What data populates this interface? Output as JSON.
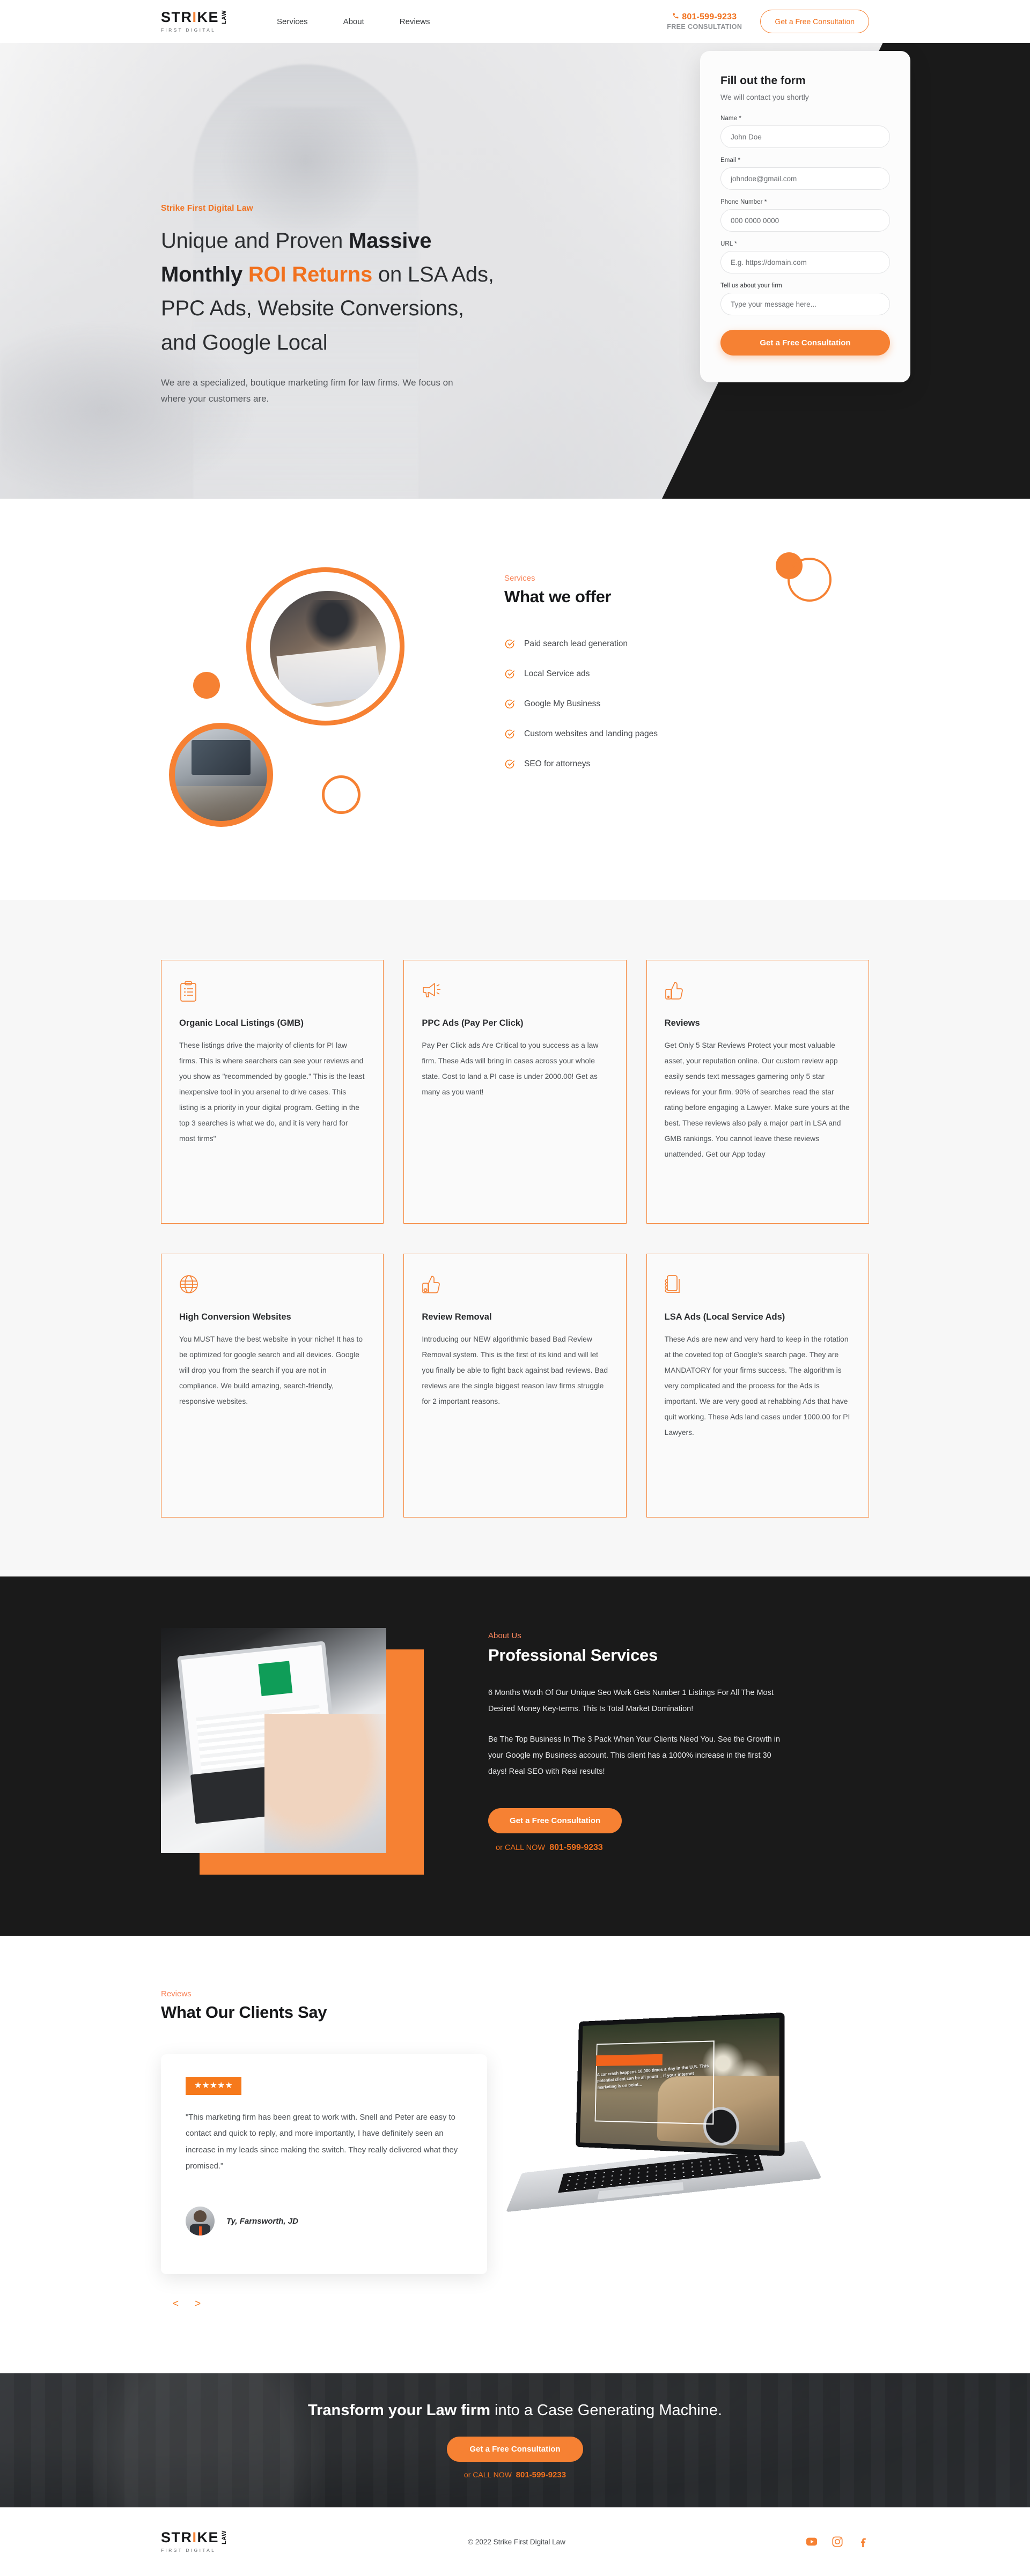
{
  "brand": {
    "logo_main": "STRIKE",
    "logo_i": "I",
    "logo_sub": "FIRST DIGITAL",
    "logo_law": "LAW",
    "accent": "#f68133",
    "accent_dark": "#f1711e",
    "dark": "#1a1a1a"
  },
  "header": {
    "nav": [
      {
        "label": "Services"
      },
      {
        "label": "About"
      },
      {
        "label": "Reviews"
      }
    ],
    "phone": "801-599-9233",
    "phone_sub": "FREE CONSULTATION",
    "cta_label": "Get a Free Consultation"
  },
  "hero": {
    "eyebrow": "Strike First Digital Law",
    "title_part1": "Unique and Proven ",
    "title_bold1": "Massive Monthly ",
    "title_hl": "ROI Returns",
    "title_part2": " on LSA Ads, PPC Ads, Website Conversions, and Google Local",
    "subtitle": "We are a specialized, boutique marketing firm for law firms. We focus on where your customers are."
  },
  "form": {
    "title": "Fill out the form",
    "subtitle": "We will contact you shortly",
    "fields": [
      {
        "label": "Name *",
        "placeholder": "John Doe"
      },
      {
        "label": "Email *",
        "placeholder": "johndoe@gmail.com"
      },
      {
        "label": "Phone Number *",
        "placeholder": "000 0000 0000"
      },
      {
        "label": "URL *",
        "placeholder": "E.g. https://domain.com"
      },
      {
        "label": "Tell us about your firm",
        "placeholder": "Type your message here..."
      }
    ],
    "submit_label": "Get a Free Consultation"
  },
  "offer": {
    "eyebrow": "Services",
    "heading": "What we offer",
    "items": [
      {
        "label": "Paid search lead generation"
      },
      {
        "label": "Local Service ads"
      },
      {
        "label": "Google My Business"
      },
      {
        "label": "Custom websites and landing pages"
      },
      {
        "label": "SEO for attorneys"
      }
    ]
  },
  "cards": [
    {
      "icon": "clipboard-icon",
      "title": "Organic Local Listings (GMB)",
      "body": "These listings drive the majority of clients for PI law firms.  This is where searchers can see your reviews and you show as \"recommended by google.\"  This is the least inexpensive tool in you arsenal to drive cases.  This listing is a priority in your digital program.  Getting in the top 3 searches is what we do, and it is very hard for most firms\""
    },
    {
      "icon": "megaphone-icon",
      "title": "PPC Ads (Pay Per Click)",
      "body": "Pay Per Click ads Are Critical to you success as a law firm.  These Ads will bring in cases across your whole state.  Cost to land a PI case is under 2000.00!  Get as many as you want!"
    },
    {
      "icon": "thumbs-up-icon",
      "title": "Reviews",
      "body": "Get Only 5 Star Reviews  Protect your most valuable asset, your reputation online.  Our custom review app easily sends text messages garnering only 5 star reviews for your firm.  90% of searches read the star rating before engaging a Lawyer.  Make  sure yours at the best.  These reviews also paly a major part in LSA and GMB rankings.  You cannot leave these reviews unattended.  Get our App today"
    },
    {
      "icon": "globe-icon",
      "title": " High Conversion Websites",
      "body": "You MUST have the best website in your niche! It has to be optimized for google search and all devices. Google will drop you from the search if you are not in compliance. We build amazing, search-friendly, responsive websites."
    },
    {
      "icon": "thumbs-up-remove-icon",
      "title": "Review Removal",
      "body": "Introducing our NEW algorithmic based Bad Review Removal system. This is the first of its kind and will let you finally be able to fight back against bad reviews. Bad reviews are the single biggest reason law firms struggle for 2 important reasons."
    },
    {
      "icon": "mobile-hand-icon",
      "title": "LSA Ads (Local Service Ads)",
      "body": "These Ads are new and very hard to keep in the rotation at the coveted top of Google's search page.  They are MANDATORY for your firms success.  The algorithm is very complicated and the process for the Ads is important.  We are very good at rehabbing Ads that have quit working.  These Ads land cases under 1000.00 for PI Lawyers."
    }
  ],
  "about": {
    "eyebrow": "About Us",
    "heading": "Professional Services",
    "paragraph1": "6 Months Worth Of Our Unique Seo Work Gets Number 1 Listings For All The Most Desired Money Key-terms. This Is Total Market Domination!",
    "paragraph2": "Be The Top Business In The 3 Pack When Your Clients Need You. See the Growth in your Google my Business account. This client has a 1000% increase in the first 30 days! Real SEO with Real results!",
    "cta_label": "Get a Free Consultation",
    "call_prefix": "or CALL NOW",
    "call_number": "801-599-9233"
  },
  "reviews": {
    "eyebrow": "Reviews",
    "heading": "What Our Clients Say",
    "stars": "★★★★★",
    "quote": "\"This marketing firm has been great to work with. Snell and Peter are easy to contact and quick to reply, and more importantly, I have definitely seen an increase in my leads since making the switch. They really delivered what they promised.\"",
    "author": "Ty, Farnsworth, JD",
    "prev_label": "<",
    "next_label": ">",
    "laptop_overlay": "A car crash happens 16,000 times a day in the U.S. This potential client can be all yours... if your internet marketing is on point..."
  },
  "cta": {
    "heading_bold": "Transform your Law firm",
    "heading_rest": " into a Case Generating Machine.",
    "button_label": "Get a Free Consultation",
    "call_prefix": "or CALL NOW",
    "call_number": "801-599-9233"
  },
  "footer": {
    "copyright": "© 2022 Strike First Digital Law",
    "social": [
      {
        "name": "youtube-icon"
      },
      {
        "name": "instagram-icon"
      },
      {
        "name": "facebook-icon"
      }
    ]
  }
}
